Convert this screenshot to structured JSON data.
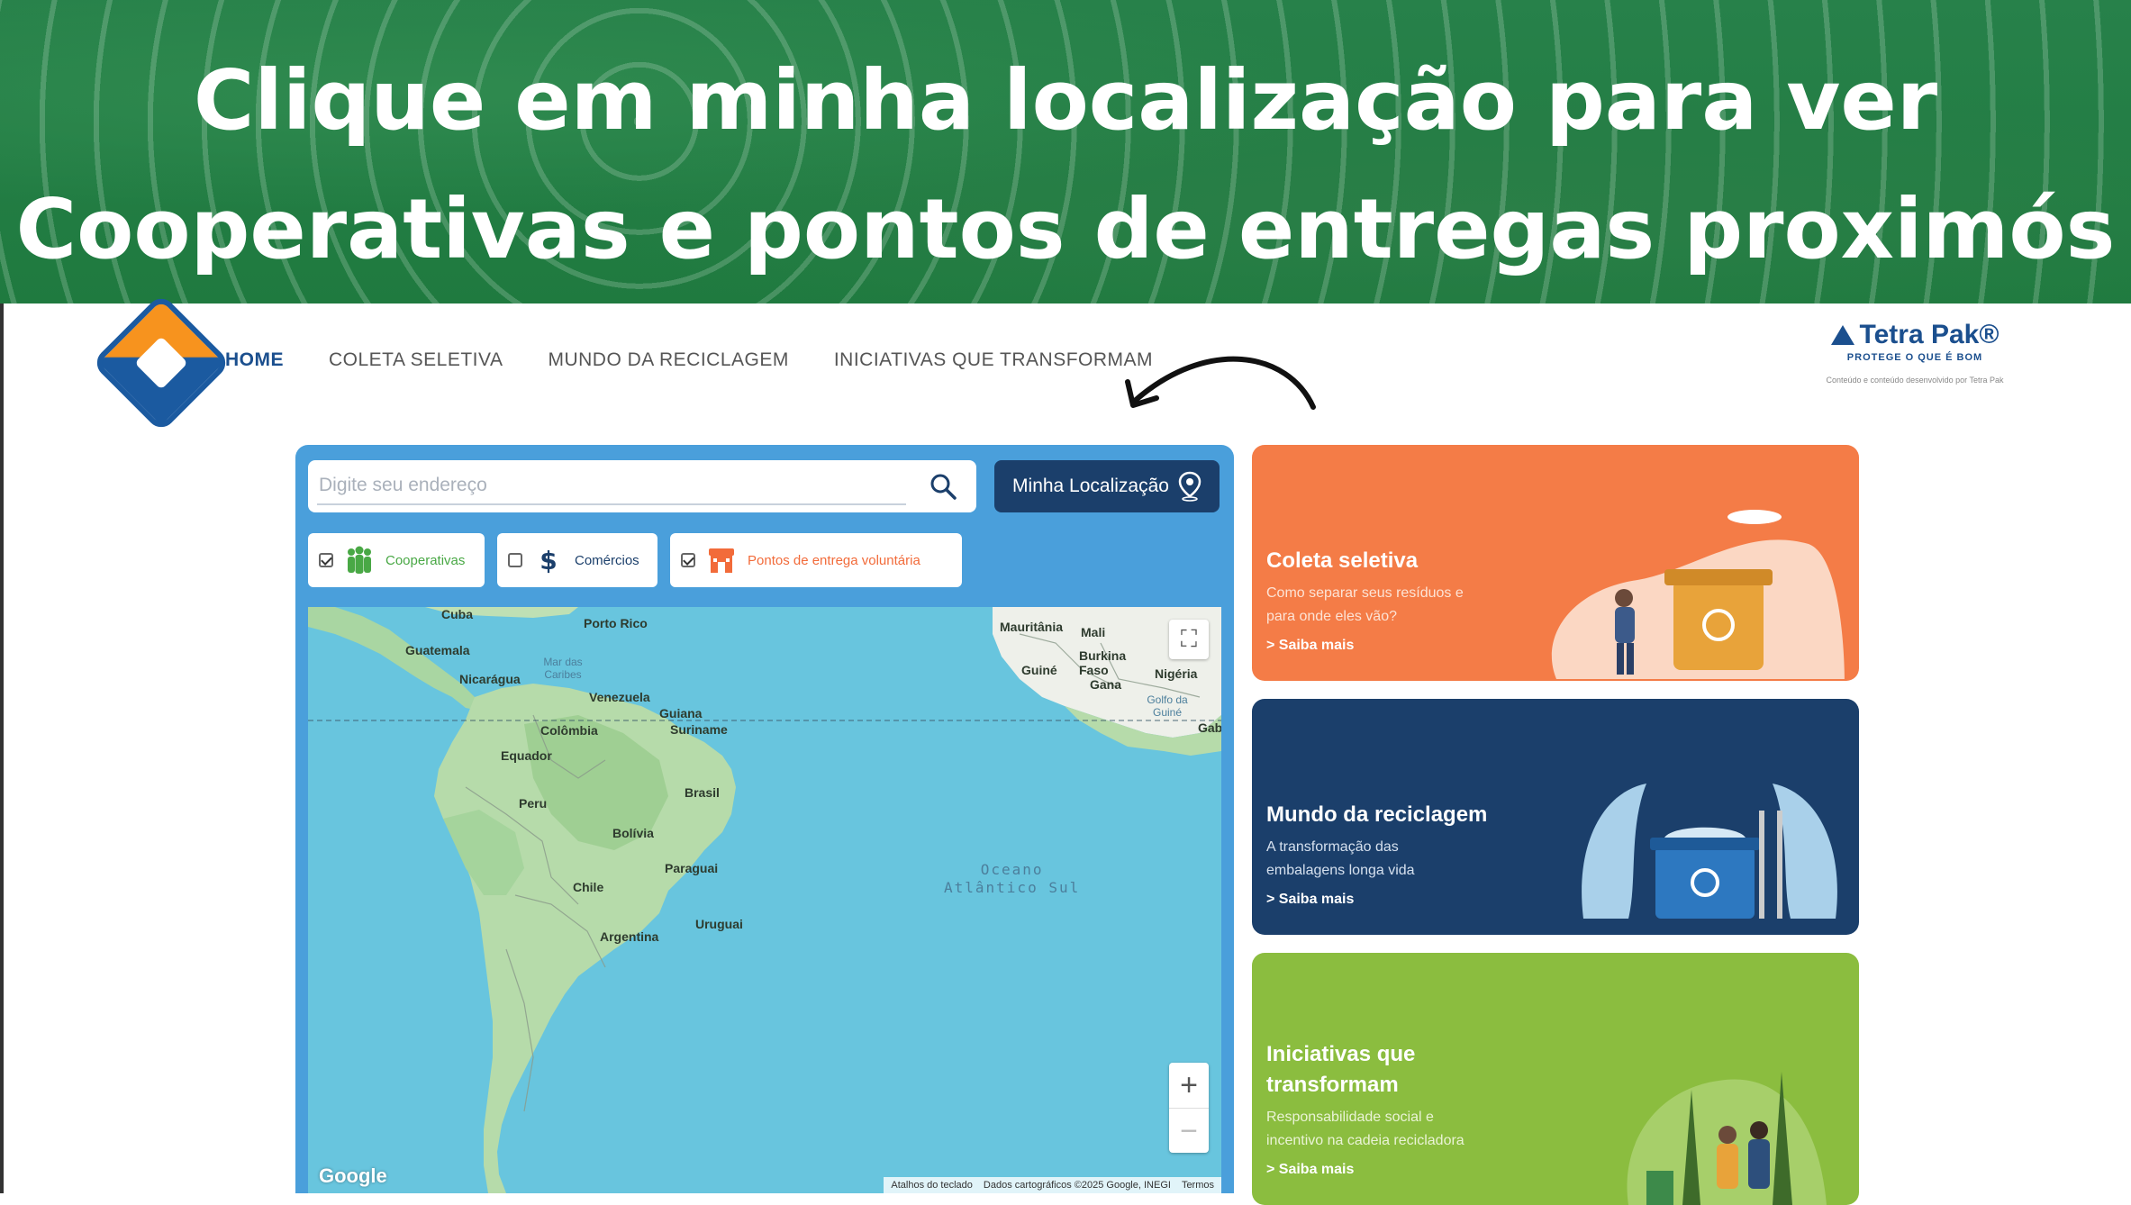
{
  "banner": {
    "headline_line1": "Clique em minha localização para ver",
    "headline_line2": "Cooperativas e pontos de entregas proximós"
  },
  "nav": {
    "items": [
      {
        "label": "HOME",
        "active": true
      },
      {
        "label": "COLETA SELETIVA",
        "active": false
      },
      {
        "label": "MUNDO DA RECICLAGEM",
        "active": false
      },
      {
        "label": "INICIATIVAS QUE TRANSFORMAM",
        "active": false
      }
    ]
  },
  "partner": {
    "brand": "Tetra Pak®",
    "slogan": "PROTEGE O QUE É BOM",
    "fine_print": "Conteúdo e conteúdo desenvolvido por Tetra Pak"
  },
  "search": {
    "placeholder": "Digite seu endereço",
    "value": "",
    "icon": "search-icon"
  },
  "location_button": {
    "label": "Minha Localização",
    "icon": "location-pin-icon"
  },
  "filters": [
    {
      "label": "Cooperativas",
      "checked": true,
      "icon": "people-icon",
      "color": "#49a845"
    },
    {
      "label": "Comércios",
      "checked": false,
      "icon": "dollar-icon",
      "color": "#1b3f6b"
    },
    {
      "label": "Pontos de entrega voluntária",
      "checked": true,
      "icon": "store-icon",
      "color": "#f26b3a"
    }
  ],
  "map": {
    "labels": {
      "cuba": "Cuba",
      "porto_rico": "Porto Rico",
      "guatemala": "Guatemala",
      "nicaragua": "Nicarágua",
      "mar_caribe": "Mar das Caribes",
      "venezuela": "Venezuela",
      "guiana": "Guiana",
      "suriname": "Suriname",
      "colombia": "Colômbia",
      "equador": "Equador",
      "peru": "Peru",
      "brasil": "Brasil",
      "bolivia": "Bolívia",
      "paraguai": "Paraguai",
      "chile": "Chile",
      "uruguai": "Uruguai",
      "argentina": "Argentina",
      "mauritania": "Mauritânia",
      "mali": "Mali",
      "burkina_faso": "Burkina Faso",
      "guine": "Guiné",
      "gana": "Gana",
      "nigeria": "Nigéria",
      "golfo_guine": "Golfo da Guiné",
      "gabao": "Gab",
      "oceano_line1": "Oceano",
      "oceano_line2": "Atlântico Sul"
    },
    "logo": "Google",
    "attribution": [
      "Atalhos do teclado",
      "Dados cartográficos ©2025 Google, INEGI",
      "Termos"
    ],
    "zoom_in": "+",
    "zoom_out": "−",
    "fullscreen": "⛶"
  },
  "cards": [
    {
      "title": "Coleta seletiva",
      "desc_line1": "Como separar seus resíduos e",
      "desc_line2": "para onde eles vão?",
      "more": "> Saiba mais",
      "color": "#f47c47"
    },
    {
      "title": "Mundo da reciclagem",
      "desc_line1": "A transformação das",
      "desc_line2": "embalagens longa vida",
      "more": "> Saiba mais",
      "color": "#1b3f6b"
    },
    {
      "title_line1": "Iniciativas que",
      "title_line2": "transformam",
      "desc_line1": "Responsabilidade social e",
      "desc_line2": "incentivo na cadeia recicladora",
      "more": "> Saiba mais",
      "color": "#8bbd3f"
    }
  ]
}
